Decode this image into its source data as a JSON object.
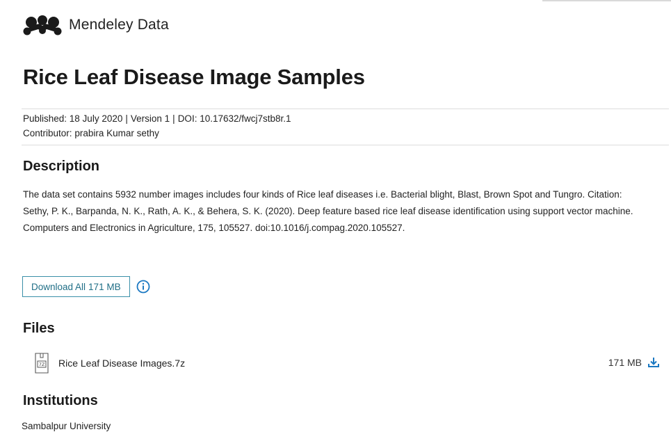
{
  "header": {
    "brand": "Mendeley Data",
    "logo_icon": "mendeley-logo-icon"
  },
  "dataset": {
    "title": "Rice Leaf Disease Image Samples",
    "published": "Published: 18 July 2020",
    "version": "Version 1",
    "doi": "DOI: 10.17632/fwcj7stb8r.1",
    "separator": "|",
    "contributor_label": "Contributor:",
    "contributor_name": "prabira Kumar sethy"
  },
  "description": {
    "heading": "Description",
    "paragraph": " The data set contains  5932 number images includes four kinds of Rice leaf diseases i.e. Bacterial blight, Blast, Brown Spot and Tungro. Citation: Sethy, P. K., Barpanda, N. K., Rath, A. K., & Behera, S. K. (2020). Deep feature based rice leaf disease identification using support vector machine. Computers and Electronics in Agriculture, 175, 105527. doi:10.1016/j.compag.2020.105527."
  },
  "download": {
    "label": "Download All",
    "size": "171 MB",
    "info_icon": "info-icon"
  },
  "files": {
    "heading": "Files",
    "items": [
      {
        "name": "Rice Leaf Disease Images.7z",
        "size": "171 MB",
        "icon": "archive-file-icon",
        "file_badge": "7Z",
        "action_icon": "download-icon"
      }
    ]
  },
  "institutions": {
    "heading": "Institutions",
    "items": [
      "Sambalpur University"
    ]
  },
  "colors": {
    "accent": "#1f6e86",
    "button_border": "#3a8fa8",
    "download_icon": "#1a78c2",
    "rule": "#dcdcdc"
  }
}
